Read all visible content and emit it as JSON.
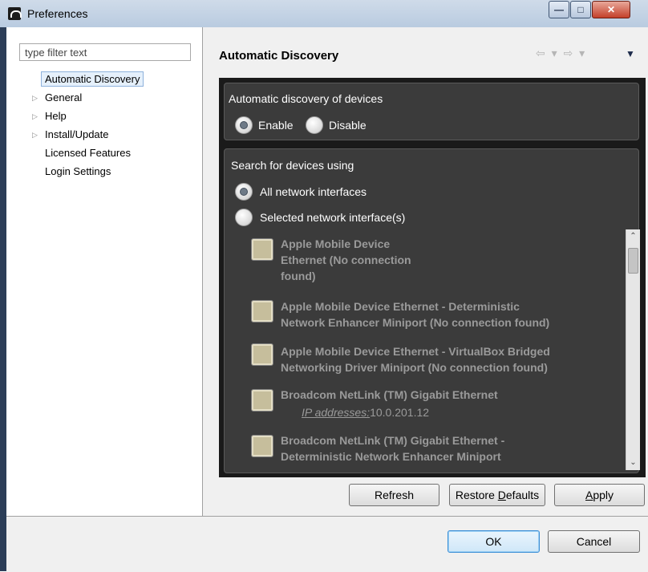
{
  "window": {
    "title": "Preferences",
    "minimize_icon": "minimize-icon",
    "maximize_icon": "maximize-icon",
    "close_icon": "close-icon"
  },
  "left": {
    "filter_placeholder": "type filter text",
    "tree": [
      {
        "label": "Automatic Discovery",
        "expandable": false,
        "selected": true
      },
      {
        "label": "General",
        "expandable": true
      },
      {
        "label": "Help",
        "expandable": true
      },
      {
        "label": "Install/Update",
        "expandable": true
      },
      {
        "label": "Licensed Features",
        "expandable": false
      },
      {
        "label": "Login Settings",
        "expandable": false
      }
    ]
  },
  "page": {
    "title": "Automatic Discovery",
    "discovery": {
      "label": "Automatic discovery of devices",
      "enable": "Enable",
      "disable": "Disable",
      "selected": "Enable"
    },
    "search": {
      "label": "Search for devices using",
      "all": "All network interfaces",
      "selected_ifaces": "Selected network interface(s)",
      "selected": "All network interfaces",
      "interfaces": [
        {
          "line1": "Apple Mobile Device",
          "line2": "Ethernet (No connection",
          "line3": "found)"
        },
        {
          "line1": "Apple Mobile Device Ethernet - Deterministic",
          "line2": "Network Enhancer Miniport (No connection found)"
        },
        {
          "line1": "Apple Mobile Device Ethernet - VirtualBox Bridged",
          "line2": "Networking Driver Miniport (No connection found)"
        },
        {
          "line1": "Broadcom NetLink (TM) Gigabit Ethernet",
          "ip_label": "IP addresses:",
          "ip_value": "10.0.201.12"
        },
        {
          "line1": "Broadcom NetLink (TM) Gigabit Ethernet -",
          "line2": "Deterministic Network Enhancer Miniport"
        }
      ]
    }
  },
  "buttons": {
    "refresh": "Refresh",
    "restore_pre": "Restore ",
    "restore_u": "D",
    "restore_post": "efaults",
    "apply_u": "A",
    "apply_post": "pply",
    "ok": "OK",
    "cancel": "Cancel"
  },
  "colors": {
    "accent": "#3d8fd6",
    "dark_panel": "#3b3b3b",
    "checkbox_fill": "#c6be9c"
  }
}
